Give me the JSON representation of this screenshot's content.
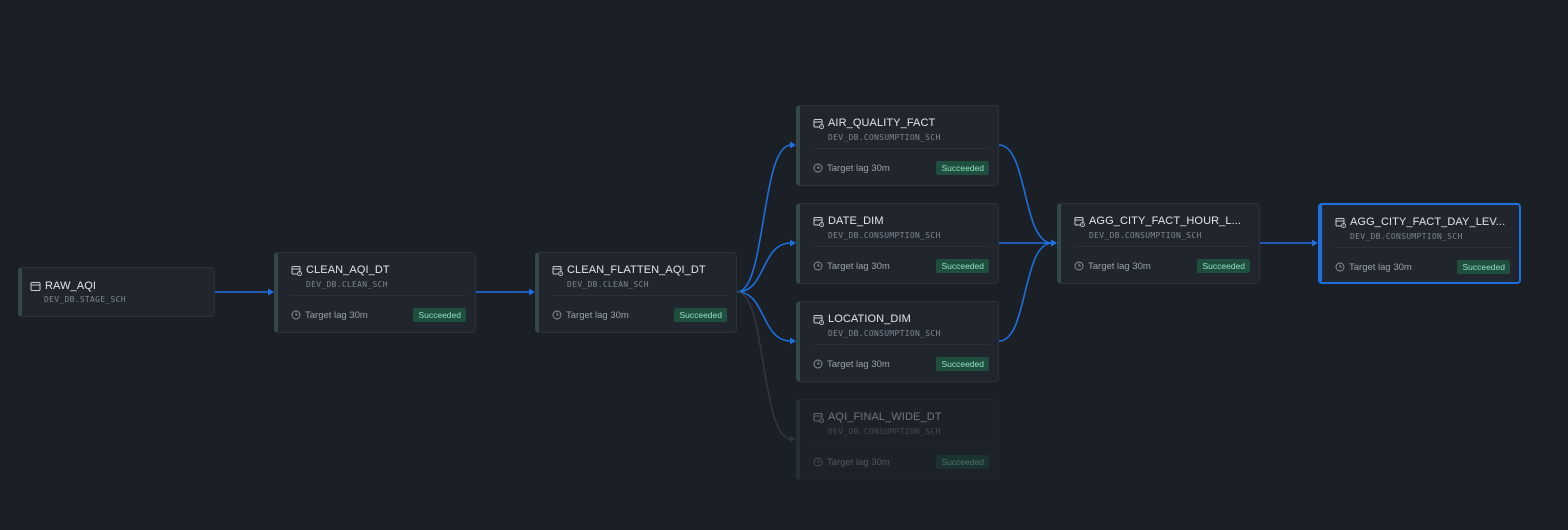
{
  "colors": {
    "background": "#1b1f26",
    "node_fill": "#20252e",
    "node_border": "#2c323c",
    "node_accent": "#34474a",
    "edge": "#1f6fe0",
    "edge_faded": "#31363e",
    "status_fill": "#1f4e3f",
    "status_text": "#8fe1bd"
  },
  "nodes": [
    {
      "id": "raw_aqi",
      "icon": "table-icon",
      "name": "RAW_AQI",
      "schema": "DEV_DB.STAGE_SCH"
    },
    {
      "id": "clean_aqi_dt",
      "icon": "dynamic-table-icon",
      "name": "CLEAN_AQI_DT",
      "schema": "DEV_DB.CLEAN_SCH",
      "lag": "Target lag 30m",
      "status": "Succeeded"
    },
    {
      "id": "clean_flatten_aqi_dt",
      "icon": "dynamic-table-icon",
      "name": "CLEAN_FLATTEN_AQI_DT",
      "schema": "DEV_DB.CLEAN_SCH",
      "lag": "Target lag 30m",
      "status": "Succeeded"
    },
    {
      "id": "air_quality_fact",
      "icon": "dynamic-table-icon",
      "name": "AIR_QUALITY_FACT",
      "schema": "DEV_DB.CONSUMPTION_SCH",
      "lag": "Target lag 30m",
      "status": "Succeeded"
    },
    {
      "id": "date_dim",
      "icon": "dynamic-table-icon",
      "name": "DATE_DIM",
      "schema": "DEV_DB.CONSUMPTION_SCH",
      "lag": "Target lag 30m",
      "status": "Succeeded"
    },
    {
      "id": "location_dim",
      "icon": "dynamic-table-icon",
      "name": "LOCATION_DIM",
      "schema": "DEV_DB.CONSUMPTION_SCH",
      "lag": "Target lag 30m",
      "status": "Succeeded"
    },
    {
      "id": "aqi_final_wide_dt",
      "icon": "dynamic-table-icon",
      "name": "AQI_FINAL_WIDE_DT",
      "schema": "DEV_DB.CONSUMPTION_SCH",
      "lag": "Target lag 30m",
      "status": "Succeeded",
      "faded": true
    },
    {
      "id": "agg_city_fact_hour",
      "icon": "dynamic-table-icon",
      "name": "AGG_CITY_FACT_HOUR_L...",
      "schema": "DEV_DB.CONSUMPTION_SCH",
      "lag": "Target lag 30m",
      "status": "Succeeded"
    },
    {
      "id": "agg_city_fact_day",
      "icon": "dynamic-table-icon",
      "name": "AGG_CITY_FACT_DAY_LEV...",
      "schema": "DEV_DB.CONSUMPTION_SCH",
      "lag": "Target lag 30m",
      "status": "Succeeded",
      "selected": true
    }
  ],
  "edges": [
    {
      "from": "raw_aqi",
      "to": "clean_aqi_dt"
    },
    {
      "from": "clean_aqi_dt",
      "to": "clean_flatten_aqi_dt"
    },
    {
      "from": "clean_flatten_aqi_dt",
      "to": "air_quality_fact"
    },
    {
      "from": "clean_flatten_aqi_dt",
      "to": "date_dim"
    },
    {
      "from": "clean_flatten_aqi_dt",
      "to": "location_dim"
    },
    {
      "from": "clean_flatten_aqi_dt",
      "to": "aqi_final_wide_dt",
      "faded": true
    },
    {
      "from": "air_quality_fact",
      "to": "agg_city_fact_hour"
    },
    {
      "from": "date_dim",
      "to": "agg_city_fact_hour"
    },
    {
      "from": "location_dim",
      "to": "agg_city_fact_hour"
    },
    {
      "from": "agg_city_fact_hour",
      "to": "agg_city_fact_day"
    }
  ]
}
